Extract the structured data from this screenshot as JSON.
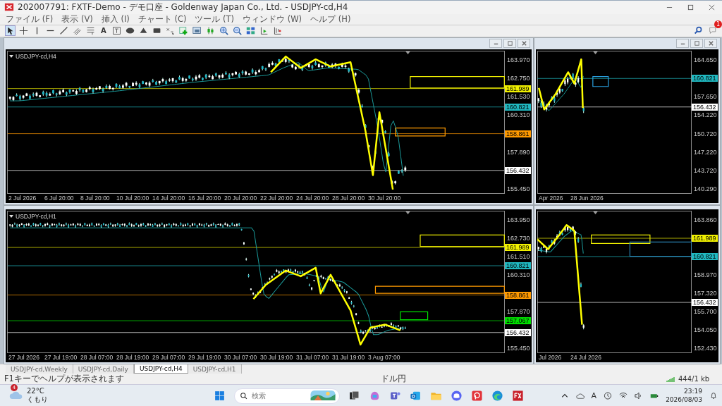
{
  "window": {
    "title": "202007791: FXTF-Demo - デモ口座 - Goldenway Japan Co., Ltd. - USDJPY-cd,H4"
  },
  "menu": [
    "ファイル (F)",
    "表示 (V)",
    "挿入 (I)",
    "チャート (C)",
    "ツール (T)",
    "ウィンドウ (W)",
    "ヘルプ (H)"
  ],
  "toolbar": {
    "text_tool": "A",
    "notification_count": "1"
  },
  "charts": [
    {
      "title": "USDJPY-cd,H4",
      "price_ticks": [
        "163.970",
        "162.750",
        "161.530",
        "160.310",
        "157.890",
        "155.450"
      ],
      "price_markers": [
        {
          "label": "161.989",
          "color": "#f0f000"
        },
        {
          "label": "160.821",
          "color": "#20b8c0"
        },
        {
          "label": "158.861",
          "color": "#ff9a00"
        },
        {
          "label": "156.432",
          "color": "#ffffff"
        }
      ],
      "time_labels": [
        "2 Jul 2026",
        "6 Jul 20:00",
        "8 Jul 20:00",
        "10 Jul 20:00",
        "14 Jul 20:00",
        "16 Jul 20:00",
        "20 Jul 20:00",
        "22 Jul 20:00",
        "24 Jul 20:00",
        "28 Jul 20:00",
        "30 Jul 20:00"
      ]
    },
    {
      "title": "USDJPY-cd,H1",
      "price_ticks": [
        "163.950",
        "162.730",
        "161.510",
        "160.310",
        "157.870",
        "155.450"
      ],
      "price_markers": [
        {
          "label": "161.989",
          "color": "#f0f000"
        },
        {
          "label": "160.821",
          "color": "#20b8c0"
        },
        {
          "label": "158.861",
          "color": "#ff9a00"
        },
        {
          "label": "157.067",
          "color": "#00e000"
        },
        {
          "label": "156.432",
          "color": "#ffffff"
        }
      ],
      "time_labels": [
        "27 Jul 2026",
        "27 Jul 19:00",
        "28 Jul 07:00",
        "28 Jul 19:00",
        "29 Jul 07:00",
        "29 Jul 19:00",
        "30 Jul 07:00",
        "30 Jul 19:00",
        "31 Jul 07:00",
        "31 Jul 19:00",
        "3 Aug 07:00"
      ]
    },
    {
      "price_ticks": [
        "164.650",
        "157.650",
        "154.220",
        "150.720",
        "147.220",
        "143.720",
        "140.290"
      ],
      "price_markers": [
        {
          "label": "160.821",
          "color": "#20b8c0"
        },
        {
          "label": "156.432",
          "color": "#ffffff"
        }
      ],
      "time_labels": [
        "Apr 2026",
        "28 Jun 2026"
      ]
    },
    {
      "price_ticks": [
        "163.860",
        "158.970",
        "157.320",
        "155.700",
        "154.050",
        "152.430"
      ],
      "price_markers": [
        {
          "label": "161.989",
          "color": "#f0f000"
        },
        {
          "label": "160.821",
          "color": "#20b8c0"
        },
        {
          "label": "156.432",
          "color": "#ffffff"
        }
      ],
      "time_labels": [
        "Jul 2026",
        "24 Jul 2026"
      ]
    }
  ],
  "tabs": [
    {
      "label": "USDJPY-cd,Weekly",
      "selected": false
    },
    {
      "label": "USDJPY-cd,Daily",
      "selected": false
    },
    {
      "label": "USDJPY-cd,H4",
      "selected": true
    },
    {
      "label": "USDJPY-cd,H1",
      "selected": false
    }
  ],
  "status_bar": {
    "hint": "F1キーでヘルプが表示されます",
    "symbol": "ドル円",
    "traffic": "444/1 kb"
  },
  "taskbar": {
    "weather_badge": "4",
    "temperature": "22°C",
    "weather": "くもり",
    "search_placeholder": "検索",
    "ime": "A",
    "time": "23:19",
    "date": "2026/08/03"
  }
}
